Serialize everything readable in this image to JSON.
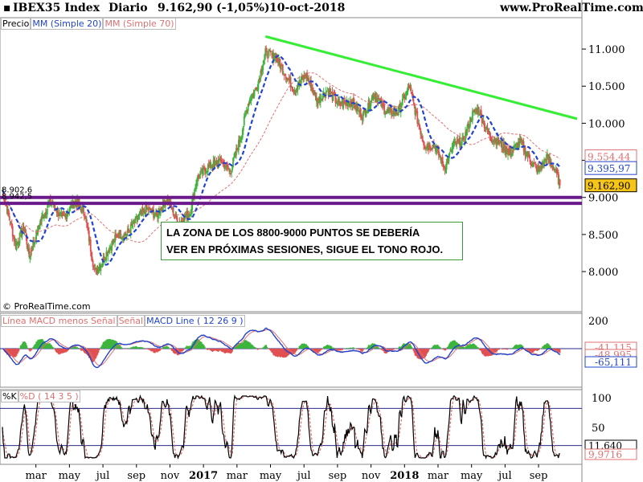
{
  "header": {
    "symbol": "IBEX35 Index",
    "period": "Diario",
    "last": "9.162,90 (-1,05%)",
    "date": "10-oct-2018",
    "site": "www.ProRealTime.com"
  },
  "copyright": "© ProRealTime.com",
  "annotation": [
    "LA ZONA DE LOS 8800-9000 PUNTOS SE DEBERÍA",
    "VER EN PRÓXIMAS SESIONES, SIGUE EL TONO ROJO."
  ],
  "colors": {
    "up": "#3db53d",
    "down": "#e05050",
    "sma20": "#2244cc",
    "sma70": "#e07070",
    "trend": "#33ee33",
    "support": "#6a1a8a"
  },
  "chart_data": [
    {
      "type": "candlestick",
      "legend": [
        "Precio",
        "MM (Simple 20)",
        "MM (Simple 70)"
      ],
      "ylim": [
        7600,
        11250
      ],
      "yticks": [
        8000,
        8500,
        9000,
        9500,
        10000,
        10500,
        11000
      ],
      "ytick_labels": [
        "8.000",
        "8.500",
        "9.000",
        "9.500",
        "10.000",
        "10.500",
        "11.000"
      ],
      "xlabels": [
        "mar",
        "may",
        "jul",
        "sep",
        "nov",
        "2017",
        "mar",
        "may",
        "jul",
        "sep",
        "nov",
        "2018",
        "mar",
        "may",
        "jul",
        "sep"
      ],
      "x_months": [
        2.0,
        4.0,
        6.0,
        8.0,
        10.0,
        12.0,
        14.0,
        16.0,
        18.0,
        20.0,
        22.0,
        24.0,
        26.0,
        28.0,
        30.0,
        32.0
      ],
      "xlim": [
        0,
        34.3
      ],
      "close": [
        {
          "m": 0.0,
          "v": 9100
        },
        {
          "m": 0.8,
          "v": 8350
        },
        {
          "m": 1.3,
          "v": 8600
        },
        {
          "m": 1.6,
          "v": 8200
        },
        {
          "m": 2.3,
          "v": 8700
        },
        {
          "m": 2.9,
          "v": 8950
        },
        {
          "m": 3.6,
          "v": 8700
        },
        {
          "m": 4.3,
          "v": 8950
        },
        {
          "m": 4.9,
          "v": 8800
        },
        {
          "m": 5.5,
          "v": 8000
        },
        {
          "m": 5.9,
          "v": 8100
        },
        {
          "m": 6.3,
          "v": 8300
        },
        {
          "m": 6.9,
          "v": 8500
        },
        {
          "m": 7.4,
          "v": 8500
        },
        {
          "m": 8.0,
          "v": 8700
        },
        {
          "m": 8.6,
          "v": 8850
        },
        {
          "m": 9.2,
          "v": 8750
        },
        {
          "m": 9.8,
          "v": 9000
        },
        {
          "m": 10.5,
          "v": 8650
        },
        {
          "m": 11.2,
          "v": 8800
        },
        {
          "m": 11.6,
          "v": 9250
        },
        {
          "m": 12.2,
          "v": 9400
        },
        {
          "m": 13.0,
          "v": 9500
        },
        {
          "m": 13.6,
          "v": 9350
        },
        {
          "m": 14.2,
          "v": 9800
        },
        {
          "m": 14.7,
          "v": 10300
        },
        {
          "m": 15.2,
          "v": 10500
        },
        {
          "m": 15.7,
          "v": 10950
        },
        {
          "m": 16.3,
          "v": 10900
        },
        {
          "m": 16.8,
          "v": 10700
        },
        {
          "m": 17.4,
          "v": 10450
        },
        {
          "m": 18.1,
          "v": 10650
        },
        {
          "m": 18.8,
          "v": 10300
        },
        {
          "m": 19.4,
          "v": 10450
        },
        {
          "m": 20.1,
          "v": 10250
        },
        {
          "m": 20.8,
          "v": 10300
        },
        {
          "m": 21.5,
          "v": 10100
        },
        {
          "m": 22.2,
          "v": 10400
        },
        {
          "m": 22.9,
          "v": 10150
        },
        {
          "m": 23.6,
          "v": 10150
        },
        {
          "m": 24.3,
          "v": 10500
        },
        {
          "m": 24.7,
          "v": 10100
        },
        {
          "m": 25.2,
          "v": 9700
        },
        {
          "m": 25.8,
          "v": 9700
        },
        {
          "m": 26.4,
          "v": 9400
        },
        {
          "m": 26.9,
          "v": 9700
        },
        {
          "m": 27.5,
          "v": 9750
        },
        {
          "m": 28.0,
          "v": 10100
        },
        {
          "m": 28.4,
          "v": 10200
        },
        {
          "m": 29.0,
          "v": 9850
        },
        {
          "m": 29.6,
          "v": 9750
        },
        {
          "m": 30.3,
          "v": 9600
        },
        {
          "m": 30.9,
          "v": 9750
        },
        {
          "m": 31.5,
          "v": 9500
        },
        {
          "m": 32.0,
          "v": 9350
        },
        {
          "m": 32.5,
          "v": 9550
        },
        {
          "m": 33.0,
          "v": 9350
        },
        {
          "m": 33.3,
          "v": 9163
        }
      ],
      "trend_line": {
        "from": {
          "m": 15.7,
          "v": 11170
        },
        "to": {
          "m": 34.3,
          "v": 10060
        }
      },
      "support_lines": [
        9000,
        8920
      ],
      "support_labels": [
        "8.902,6",
        "8.942,5"
      ],
      "price_tags": [
        {
          "label": "9.554,44",
          "v": 9554,
          "color": "#e07070"
        },
        {
          "label": "9.395,97",
          "v": 9396,
          "color": "#2244cc"
        },
        {
          "label": "9.162,90",
          "v": 9163,
          "color": "#000000"
        }
      ]
    },
    {
      "type": "bar+line",
      "legend": [
        "Línea MACD menos Señal",
        "Señal",
        "MACD Line ( 12 26 9 )"
      ],
      "ytick_labels": [
        "200"
      ],
      "value_tags": [
        "-41,115",
        "-48,995",
        "-65,111"
      ]
    },
    {
      "type": "line",
      "legend": [
        "%K",
        "%D ( 14 3 5 )"
      ],
      "ytick_labels": [
        "100",
        "50"
      ],
      "bounds": [
        80,
        20
      ],
      "value_tags": [
        "11,640",
        "9,9716"
      ]
    }
  ]
}
